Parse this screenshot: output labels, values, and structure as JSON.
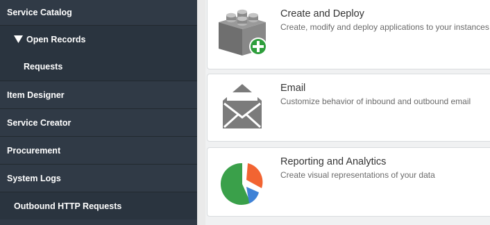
{
  "sidebar": {
    "items": [
      {
        "label": "Service Catalog"
      },
      {
        "label": "Open Records",
        "icon": "triangle-down-icon"
      },
      {
        "label": "Requests"
      },
      {
        "label": "Item Designer"
      },
      {
        "label": "Service Creator"
      },
      {
        "label": "Procurement"
      },
      {
        "label": "System Logs"
      },
      {
        "label": "Outbound HTTP Requests"
      }
    ]
  },
  "cards": [
    {
      "title": "Create and Deploy",
      "description": "Create, modify and deploy applications to your instances",
      "icon": "create-deploy-icon"
    },
    {
      "title": "Email",
      "description": "Customize behavior of inbound and outbound email",
      "icon": "envelope-icon"
    },
    {
      "title": "Reporting and Analytics",
      "description": "Create visual representations of your data",
      "icon": "pie-chart-icon"
    }
  ],
  "colors": {
    "sidebar_bg": "#303a46",
    "sidebar_dark_row": "#2a343f",
    "main_bg": "#f0f1f2",
    "icon_grey": "#7b7b7b",
    "plus_green": "#2e9e3c",
    "pie_green": "#3aa04a",
    "pie_orange": "#f26432",
    "pie_blue": "#3f82d6"
  }
}
